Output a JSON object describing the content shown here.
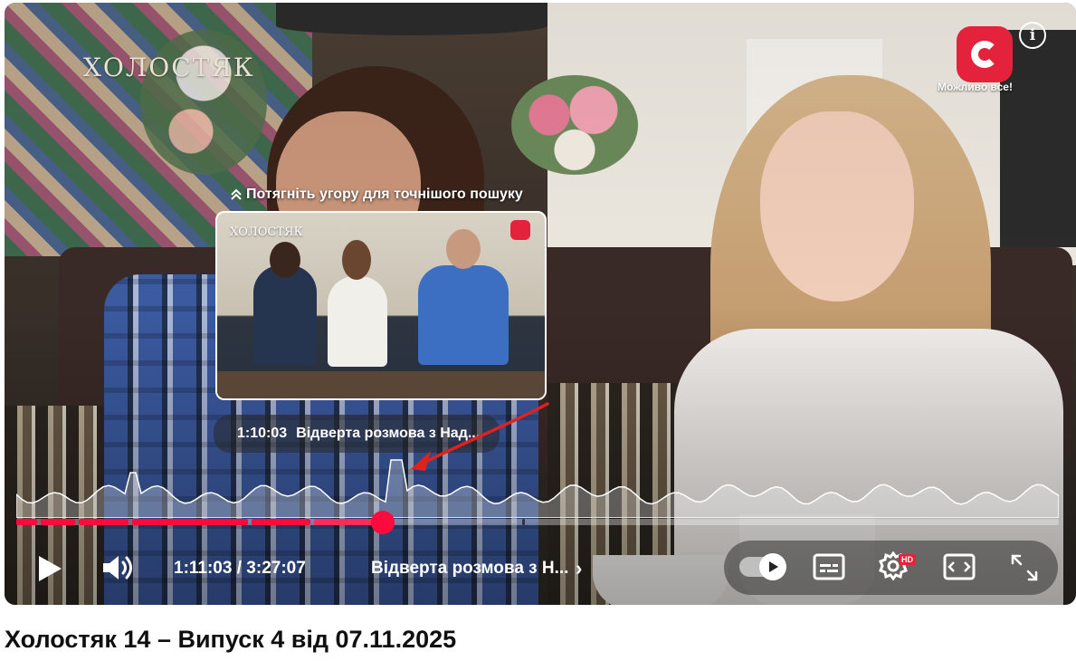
{
  "video": {
    "show_logo": "ХОЛОСТЯК",
    "channel_slogan": "Можливо все!",
    "hint": "Потягніть угору для точнішого пошуку",
    "preview": {
      "logo": "ХОЛОСТЯК",
      "timestamp": "1:10:03",
      "chapter": "Відверта розмова з Над..."
    },
    "progress": {
      "elapsed_fraction": 0.3495,
      "chapter_marks_fraction": [
        0.022,
        0.058,
        0.109,
        0.224,
        0.284,
        0.485
      ]
    },
    "controls": {
      "current_time": "1:11:03",
      "separator": " / ",
      "duration": "3:27:07",
      "current_chapter": "Відверта розмова з Н...",
      "hd_badge": "HD"
    },
    "icons": [
      "play-icon",
      "volume-icon",
      "chevron-right-icon",
      "autoplay-toggle",
      "subtitles-icon",
      "settings-icon",
      "miniplayer-icon",
      "fullscreen-icon",
      "info-icon",
      "info-arrow-icon"
    ]
  },
  "page": {
    "title": "Холостяк 14 – Випуск 4 від 07.11.2025"
  },
  "colors": {
    "accent_red": "#ff0a3c",
    "channel_red": "#e5223b"
  }
}
